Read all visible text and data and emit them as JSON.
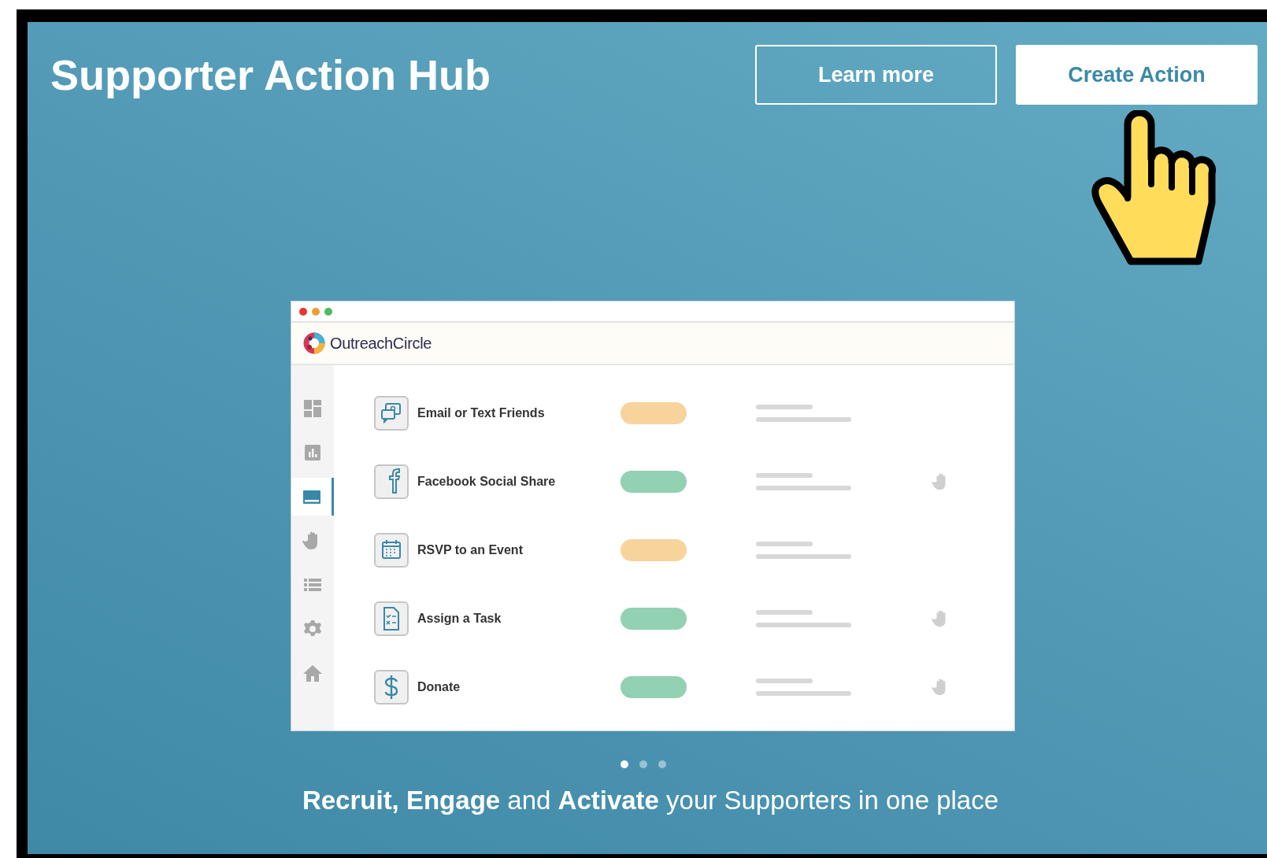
{
  "header": {
    "title": "Supporter Action Hub",
    "buttons": [
      {
        "label": "Learn more",
        "kind": "outline"
      },
      {
        "label": "Create Action",
        "kind": "filled"
      }
    ]
  },
  "app_window": {
    "brand": "OutreachCircle",
    "sidebar": {
      "items": [
        {
          "kind": "dashboard",
          "selected": false
        },
        {
          "kind": "chart",
          "selected": false
        },
        {
          "kind": "inbox",
          "selected": true
        },
        {
          "kind": "hand",
          "selected": false
        },
        {
          "kind": "list",
          "selected": false
        },
        {
          "kind": "gear",
          "selected": false
        },
        {
          "kind": "home",
          "selected": false
        }
      ]
    },
    "actions": [
      {
        "label": "Email or Text Friends",
        "kind": "email",
        "color": "#f7d49c",
        "hand": false
      },
      {
        "label": "Facebook Social Share",
        "kind": "facebook",
        "color": "#92d1b2",
        "hand": true
      },
      {
        "label": "RSVP to an Event",
        "kind": "calendar",
        "color": "#f7d49c",
        "hand": false
      },
      {
        "label": "Assign a Task",
        "kind": "task",
        "color": "#92d1b2",
        "hand": true
      },
      {
        "label": "Donate",
        "kind": "donate",
        "color": "#92d1b2",
        "hand": true
      }
    ]
  },
  "carousel": {
    "dots": [
      {
        "selected": true
      },
      {
        "selected": false
      },
      {
        "selected": false
      }
    ]
  },
  "tagline": "**Recruit, Engage** and **Activate** your Supporters in one place"
}
